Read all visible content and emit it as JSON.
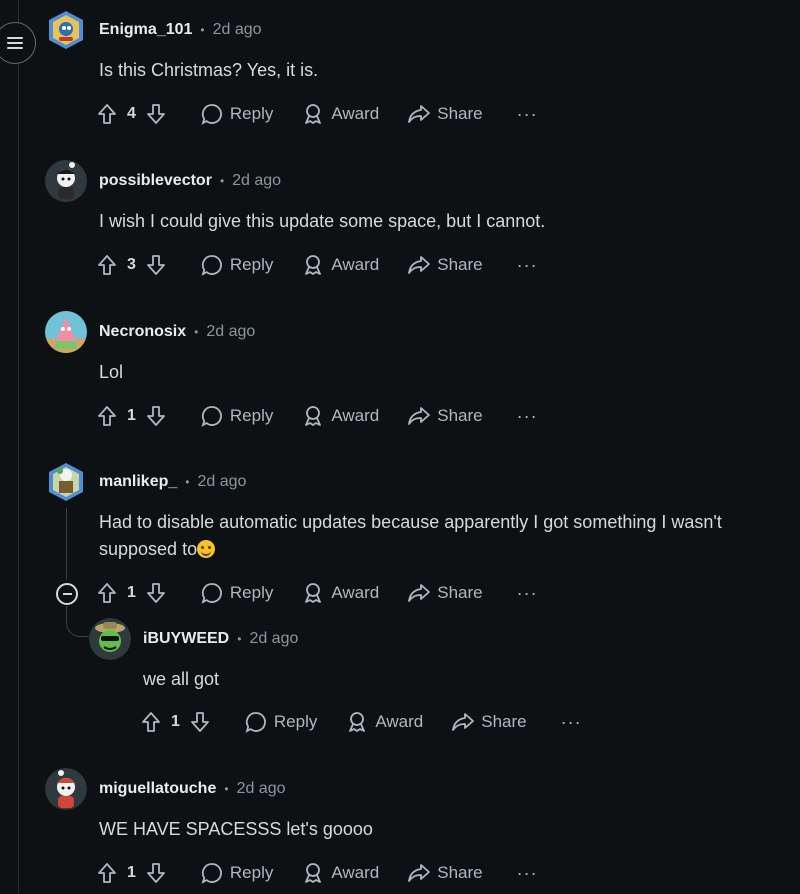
{
  "comments": [
    {
      "author": "Enigma_101",
      "time": "2d ago",
      "text": "Is this Christmas? Yes, it is.",
      "votes": "4",
      "reply": "Reply",
      "award": "Award",
      "share": "Share"
    },
    {
      "author": "possiblevector",
      "time": "2d ago",
      "text": "I wish I could give this update some space, but I cannot.",
      "votes": "3",
      "reply": "Reply",
      "award": "Award",
      "share": "Share"
    },
    {
      "author": "Necronosix",
      "time": "2d ago",
      "text": "Lol",
      "votes": "1",
      "reply": "Reply",
      "award": "Award",
      "share": "Share"
    },
    {
      "author": "manlikep_",
      "time": "2d ago",
      "text": "Had to disable automatic updates because apparently I got something I wasn't supposed to",
      "votes": "1",
      "reply": "Reply",
      "award": "Award",
      "share": "Share"
    },
    {
      "author": "iBUYWEED",
      "time": "2d ago",
      "text": "we all got",
      "votes": "1",
      "reply": "Reply",
      "award": "Award",
      "share": "Share"
    },
    {
      "author": "miguellatouche",
      "time": "2d ago",
      "text": "WE HAVE SPACESSS let's goooo",
      "votes": "1",
      "reply": "Reply",
      "award": "Award",
      "share": "Share"
    }
  ],
  "separator": "•",
  "more": "···",
  "colors": {
    "background": "#0e1113",
    "text": "#d7dadc",
    "muted": "#8b979c"
  }
}
